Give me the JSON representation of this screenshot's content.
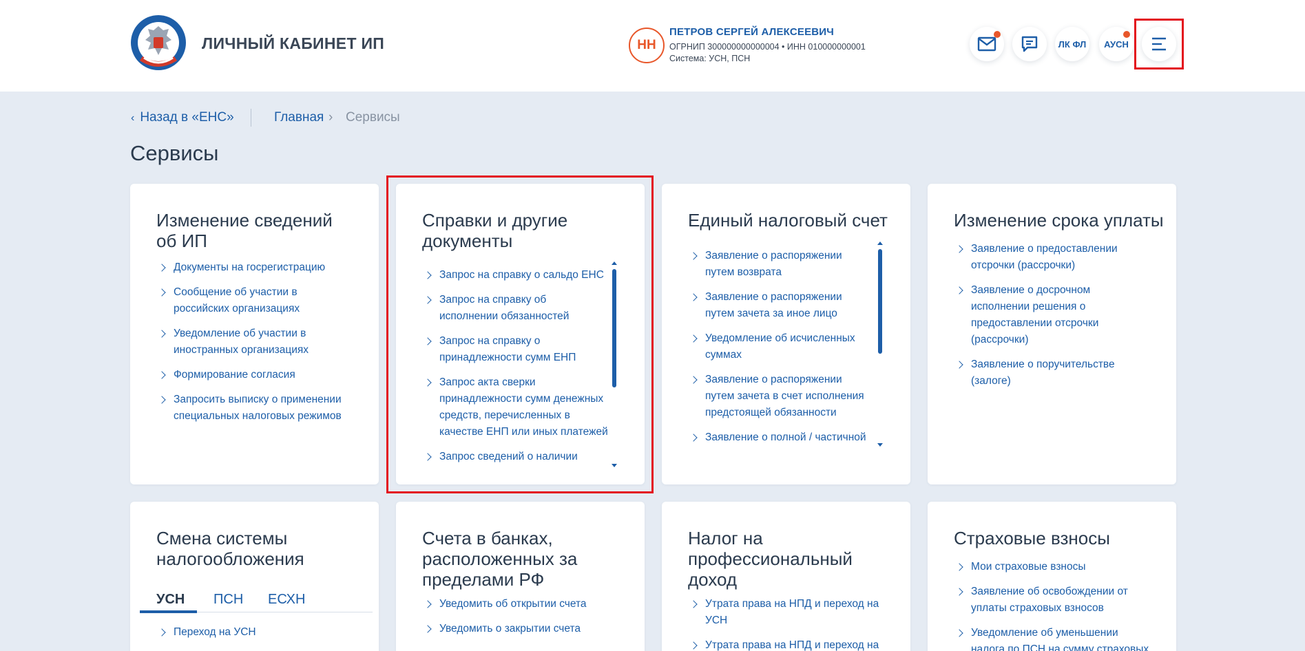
{
  "header": {
    "app_title": "ЛИЧНЫЙ КАБИНЕТ ИП",
    "user": {
      "initials": "НН",
      "name": "ПЕТРОВ СЕРГЕЙ АЛЕКСЕЕВИЧ",
      "ids": "ОГРНИП 300000000000004 • ИНН 010000000001",
      "system": "Система: УСН, ПСН"
    },
    "buttons": {
      "lk_fl": "ЛК ФЛ",
      "ausn": "АУСН"
    },
    "accent_color": "#1d5ea8",
    "notification_color": "#e8572a"
  },
  "breadcrumb": {
    "back": "Назад в «ЕНС»",
    "home": "Главная",
    "separator": "›",
    "current": "Сервисы"
  },
  "page_title": "Сервисы",
  "cards": [
    {
      "title_lines": [
        "Изменение сведений",
        "об ИП"
      ],
      "items": [
        [
          "Документы на госрегистрацию"
        ],
        [
          "Сообщение об участии в",
          "российских организациях"
        ],
        [
          "Уведомление об участии в",
          "иностранных организациях"
        ],
        [
          "Формирование согласия"
        ],
        [
          "Запросить выписку о применении",
          "специальных налоговых режимов"
        ]
      ]
    },
    {
      "title_lines": [
        "Справки и другие",
        "документы"
      ],
      "items": [
        [
          "Запрос на справку о сальдо ЕНС"
        ],
        [
          "Запрос на справку об",
          "исполнении обязанностей"
        ],
        [
          "Запрос на справку о",
          "принадлежности сумм ЕНП"
        ],
        [
          "Запрос акта сверки",
          "принадлежности сумм денежных",
          "средств, перечисленных в",
          "качестве ЕНП или иных платежей"
        ],
        [
          "Запрос сведений о наличии"
        ]
      ]
    },
    {
      "title_lines": [
        "Единый налоговый счет"
      ],
      "items": [
        [
          "Заявление о распоряжении",
          "путем возврата"
        ],
        [
          "Заявление о распоряжении",
          "путем зачета за иное лицо"
        ],
        [
          "Уведомление об исчисленных",
          "суммах"
        ],
        [
          "Заявление о распоряжении",
          "путем зачета в счет исполнения",
          "предстоящей обязанности"
        ],
        [
          "Заявление о полной / частичной"
        ]
      ]
    },
    {
      "title_lines": [
        "Изменение срока уплаты"
      ],
      "items": [
        [
          "Заявление о предоставлении",
          "отсрочки (рассрочки)"
        ],
        [
          "Заявление о досрочном",
          "исполнении решения о",
          "предоставлении отсрочки",
          "(рассрочки)"
        ],
        [
          "Заявление о поручительстве",
          "(залоге)"
        ]
      ]
    },
    {
      "title_lines": [
        "Смена системы",
        "налогообложения"
      ],
      "tabs": [
        "УСН",
        "ПСН",
        "ЕСХН"
      ],
      "active_tab": "УСН",
      "items": [
        [
          "Переход на УСН"
        ]
      ]
    },
    {
      "title_lines": [
        "Счета в банках,",
        "расположенных за",
        "пределами РФ"
      ],
      "items": [
        [
          "Уведомить об открытии счета"
        ],
        [
          "Уведомить о закрытии счета"
        ]
      ]
    },
    {
      "title_lines": [
        "Налог на",
        "профессиональный",
        "доход"
      ],
      "items": [
        [
          "Утрата права на НПД и переход на",
          "УСН"
        ],
        [
          "Утрата права на НПД и переход на"
        ]
      ]
    },
    {
      "title_lines": [
        "Страховые взносы"
      ],
      "items": [
        [
          "Мои страховые взносы"
        ],
        [
          "Заявление об освобождении от",
          "уплаты страховых взносов"
        ],
        [
          "Уведомление об уменьшении",
          "налога по ПСН на сумму страховых"
        ]
      ]
    }
  ]
}
